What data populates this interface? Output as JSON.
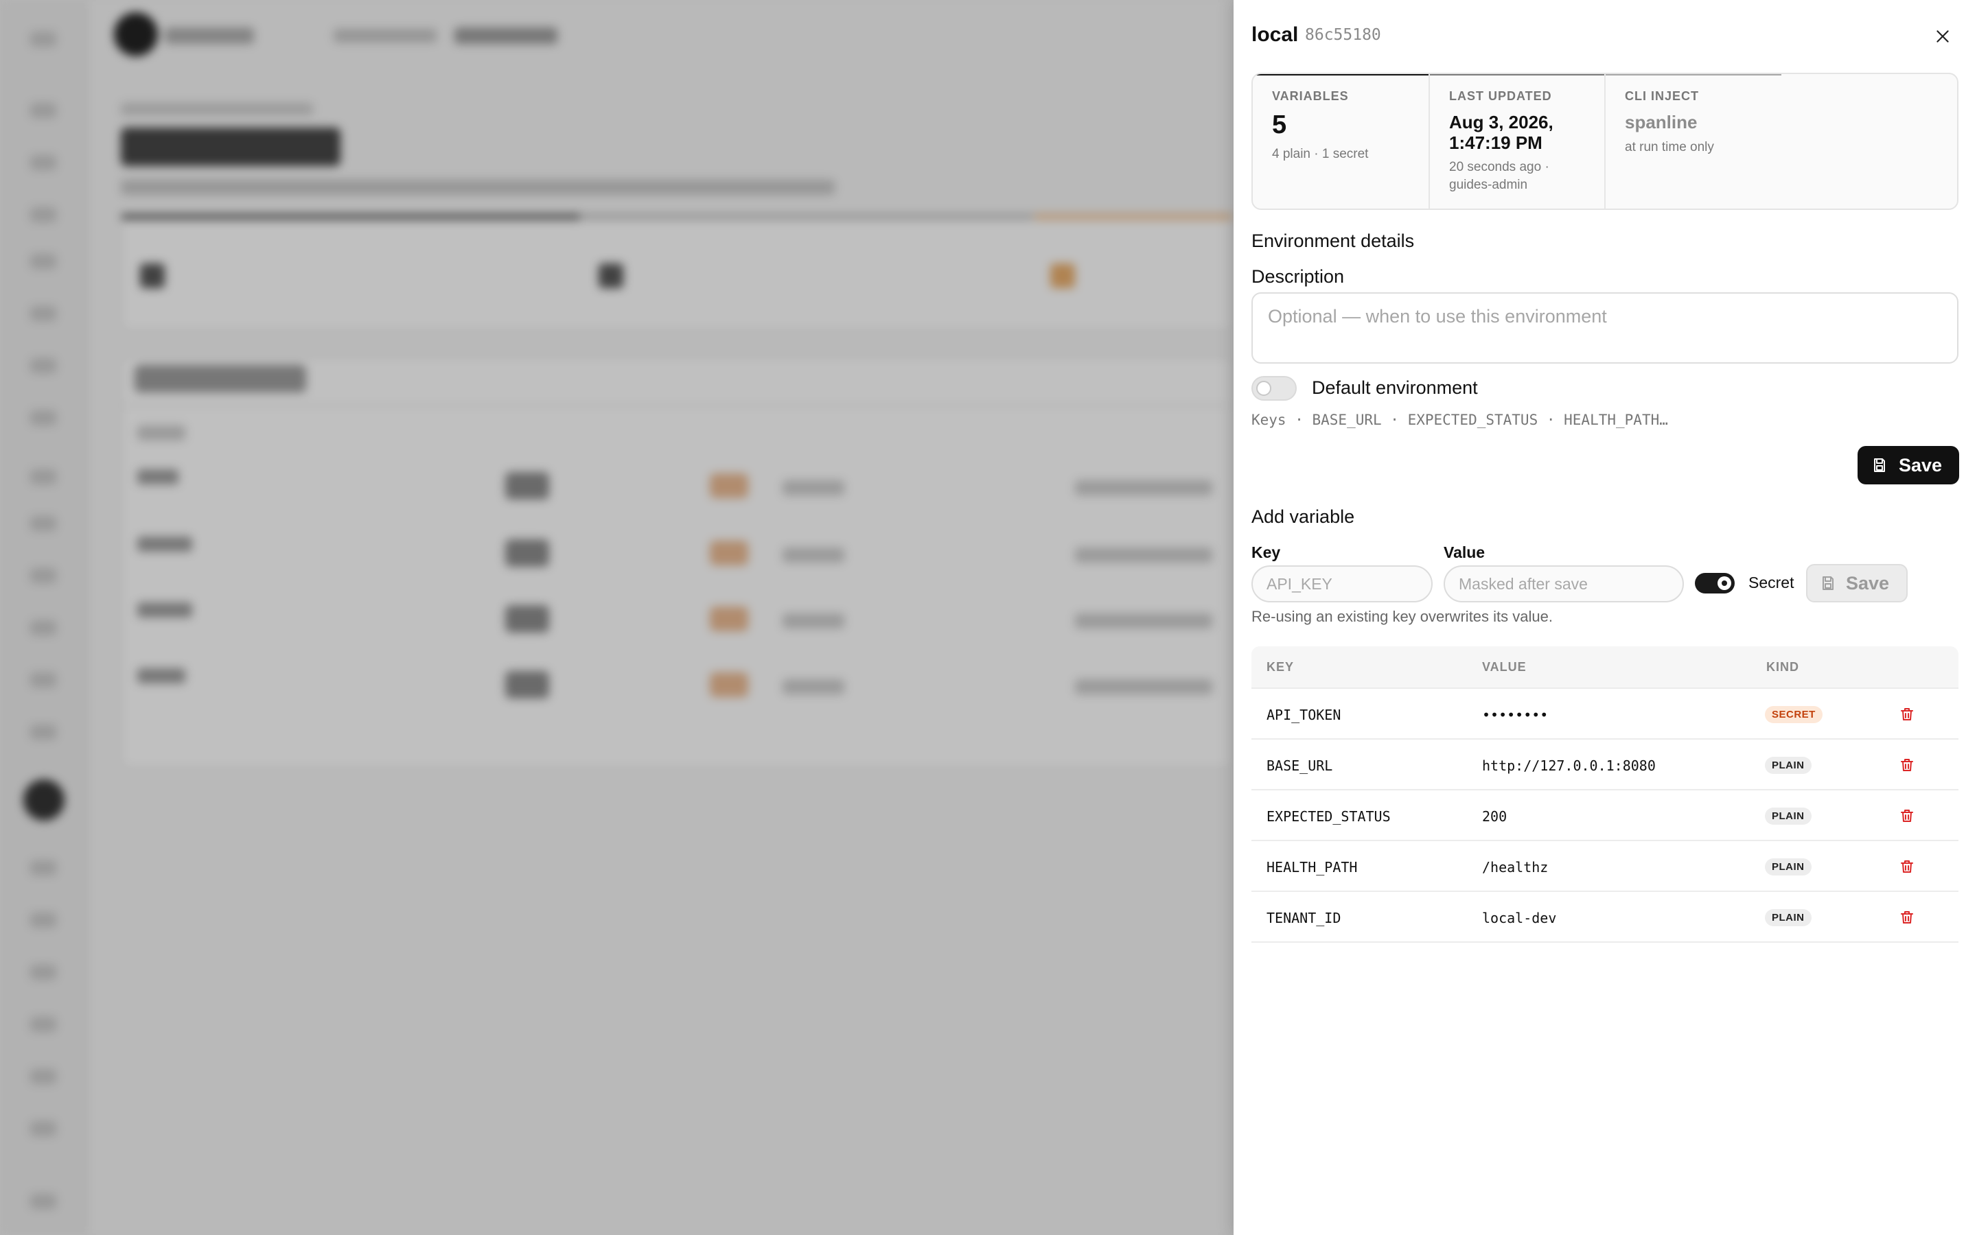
{
  "drawer": {
    "title": "local",
    "env_id": "86c55180"
  },
  "stats": {
    "variables": {
      "label": "VARIABLES",
      "value": "5",
      "sub": "4 plain · 1 secret"
    },
    "last_updated": {
      "label": "LAST UPDATED",
      "value": "Aug 3, 2026, 1:47:19 PM",
      "sub": "20 seconds ago · guides-admin"
    },
    "cli_inject": {
      "label": "CLI INJECT",
      "value": "spanline",
      "sub": "at run time only"
    }
  },
  "details": {
    "heading": "Environment details",
    "description_label": "Description",
    "description_placeholder": "Optional — when to use this environment",
    "description_value": "",
    "default_label": "Default environment",
    "default_on": false,
    "keys_line": "Keys · BASE_URL · EXPECTED_STATUS · HEALTH_PATH…",
    "save_label": "Save"
  },
  "add_variable": {
    "heading": "Add variable",
    "key_label": "Key",
    "key_placeholder": "API_KEY",
    "value_label": "Value",
    "value_placeholder": "Masked after save",
    "secret_label": "Secret",
    "secret_on": true,
    "save_label": "Save",
    "note": "Re-using an existing key overwrites its value."
  },
  "table": {
    "headers": {
      "key": "KEY",
      "value": "VALUE",
      "kind": "KIND"
    },
    "rows": [
      {
        "key": "API_TOKEN",
        "value": "••••••••",
        "kind": "SECRET"
      },
      {
        "key": "BASE_URL",
        "value": "http://127.0.0.1:8080",
        "kind": "PLAIN"
      },
      {
        "key": "EXPECTED_STATUS",
        "value": "200",
        "kind": "PLAIN"
      },
      {
        "key": "HEALTH_PATH",
        "value": "/healthz",
        "kind": "PLAIN"
      },
      {
        "key": "TENANT_ID",
        "value": "local-dev",
        "kind": "PLAIN"
      }
    ]
  },
  "colors": {
    "accent": "#111111",
    "secret_badge_bg": "#fde8d8",
    "secret_badge_fg": "#c2410c",
    "delete_icon": "#dc2626"
  },
  "icons": {
    "close": "close-icon",
    "save": "save-icon",
    "delete": "trash-icon"
  }
}
